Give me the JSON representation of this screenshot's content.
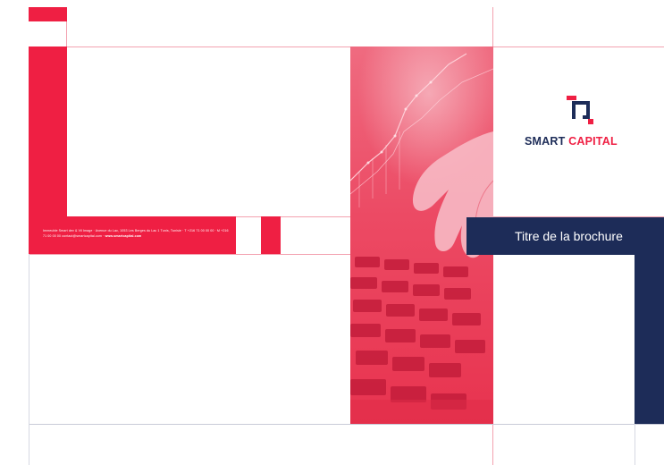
{
  "brand": {
    "name_part1": "SMART",
    "name_part2": "CAPITAL",
    "logo_icon": "smart-capital-logo-icon"
  },
  "cover": {
    "title": "Titre de la brochure"
  },
  "contact": {
    "address_line": "Immeuble Smart dev & Vil Image · Avenue du Lac, 1053 Les Berges du Lac 1 Tunis, Tunisie · T +216 71 00 00 00 · M +216 71 00 00 00",
    "email": "contact@smartcapital.com",
    "website": "www.smartcapital.com"
  },
  "colors": {
    "brand_red": "#ef1f43",
    "brand_navy": "#1d2c58",
    "guide_pink": "#f3a2b0"
  },
  "photo": {
    "subject": "hand typing on laptop keyboard with financial chart overlay"
  }
}
